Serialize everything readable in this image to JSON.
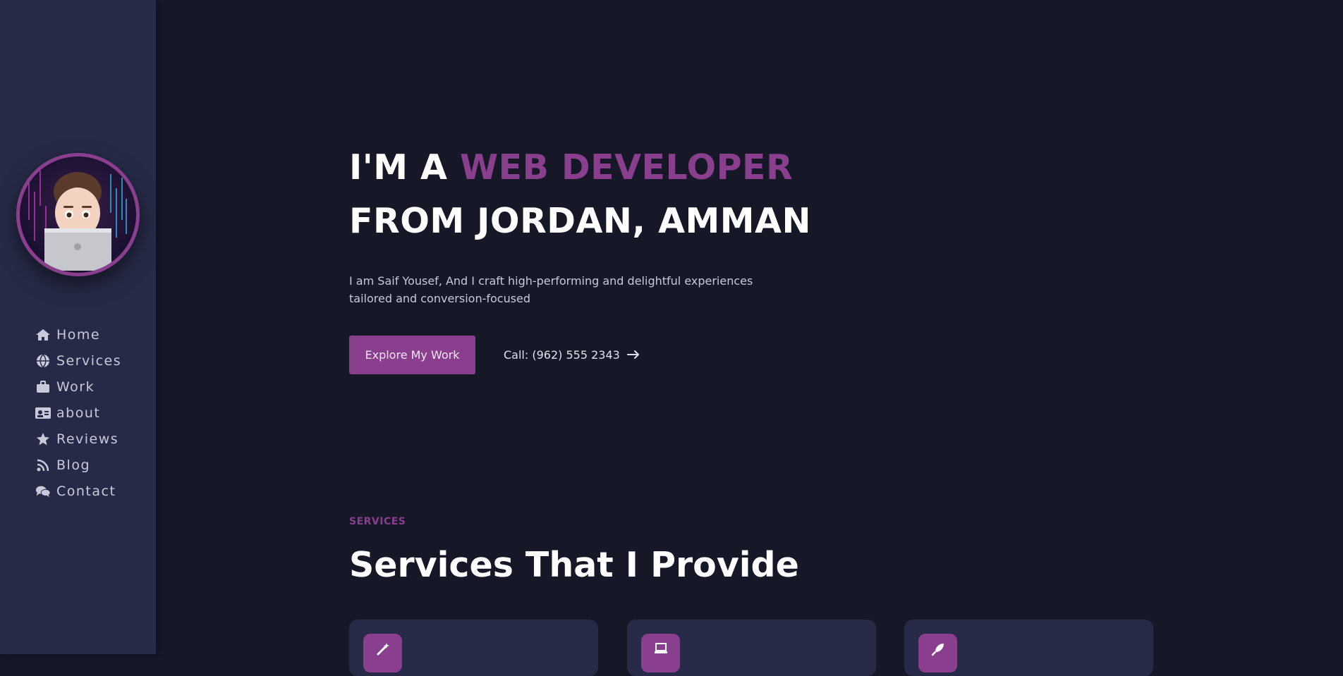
{
  "colors": {
    "background": "#161727",
    "sidebar": "#262a46",
    "accent": "#8a3f8e",
    "text_muted": "#c9cad9"
  },
  "sidebar": {
    "avatar_icon": "memoji-avatar",
    "nav": [
      {
        "label": "Home",
        "icon": "home-icon"
      },
      {
        "label": "Services",
        "icon": "globe-icon"
      },
      {
        "label": "Work",
        "icon": "briefcase-icon"
      },
      {
        "label": "about",
        "icon": "id-card-icon"
      },
      {
        "label": "Reviews",
        "icon": "star-icon"
      },
      {
        "label": "Blog",
        "icon": "rss-icon"
      },
      {
        "label": "Contact",
        "icon": "comments-icon"
      }
    ]
  },
  "hero": {
    "line1_prefix": "I'M A ",
    "line1_accent": "WEB DEVELOPER",
    "line2": "FROM JORDAN, AMMAN",
    "description": "I am Saif Yousef, And I craft high-performing and delightful experiences tailored and conversion-focused",
    "cta_label": "Explore My Work",
    "call_label": "Call: (962) 555 2343",
    "call_icon": "arrow-right-icon"
  },
  "services": {
    "label": "SERVICES",
    "title": "Services That I Provide",
    "cards": [
      {
        "icon": "magic-wand-icon"
      },
      {
        "icon": "laptop-icon"
      },
      {
        "icon": "rocket-icon"
      }
    ]
  }
}
